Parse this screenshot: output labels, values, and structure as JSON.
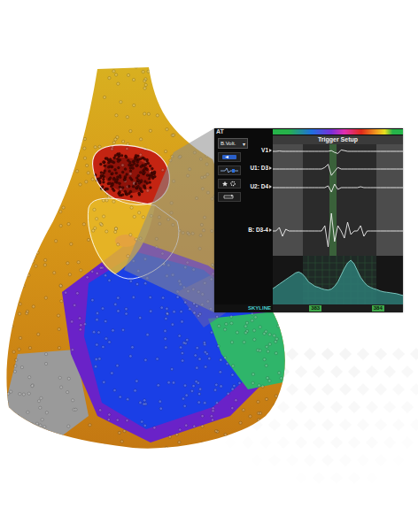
{
  "header": {
    "top_label": "AT",
    "title": "Trigger Setup"
  },
  "sidebar": {
    "dropdown": {
      "value": "B.Volt.",
      "arrow": "▾"
    }
  },
  "channels": [
    {
      "label": "V1",
      "values": [
        0,
        0,
        0.05,
        0,
        0,
        0,
        0,
        0,
        0,
        0,
        0,
        0,
        0,
        0,
        0,
        0,
        0,
        0,
        0.1,
        -0.15,
        -0.3,
        0.2,
        0.1,
        0,
        0,
        0,
        0,
        0,
        0,
        0,
        0,
        0,
        0,
        0,
        0,
        0,
        0,
        0,
        0,
        0,
        0
      ]
    },
    {
      "label": "U1: D3",
      "values": [
        0,
        0,
        0,
        0,
        0,
        0,
        0,
        0,
        0,
        0,
        0,
        0,
        0,
        0,
        0,
        0,
        0.2,
        0.6,
        -0.8,
        -0.3,
        0.2,
        0,
        0,
        0,
        0,
        0,
        0,
        0,
        0,
        0,
        0,
        0,
        0,
        0,
        0,
        0,
        0,
        0,
        0,
        0,
        0
      ]
    },
    {
      "label": "U2: D4",
      "values": [
        0,
        0,
        0,
        0,
        0,
        0,
        0,
        0,
        0,
        0,
        0,
        0,
        0,
        0,
        0,
        0,
        0,
        0.2,
        -0.5,
        0.4,
        -0.2,
        0,
        0,
        0,
        0,
        0,
        0,
        0.1,
        0,
        0,
        0,
        0,
        0,
        0,
        0,
        0,
        0,
        0,
        0,
        0,
        0
      ]
    },
    {
      "label": "B: D3-4",
      "values": [
        0,
        0,
        0.2,
        -0.3,
        0.1,
        0,
        0,
        0,
        0,
        0,
        0,
        0,
        0,
        0,
        0,
        0,
        0.3,
        -0.9,
        1,
        -0.6,
        0.3,
        0,
        -0.4,
        0.5,
        -0.2,
        0,
        0,
        0.3,
        -0.3,
        0,
        0,
        0,
        0,
        0,
        0,
        0,
        0,
        0,
        0,
        0,
        0
      ]
    }
  ],
  "skyline": {
    "label": "SKYLINE",
    "start": "383",
    "end": "384",
    "values": [
      0.35,
      0.4,
      0.45,
      0.5,
      0.55,
      0.6,
      0.65,
      0.7,
      0.72,
      0.68,
      0.6,
      0.5,
      0.45,
      0.4,
      0.38,
      0.35,
      0.33,
      0.32,
      0.34,
      0.4,
      0.5,
      0.65,
      0.8,
      0.92,
      0.98,
      0.9,
      0.75,
      0.6,
      0.5,
      0.42,
      0.38,
      0.35,
      0.33,
      0.3,
      0.28,
      0.27,
      0.26,
      0.25,
      0.24,
      0.22,
      0.2
    ]
  }
}
